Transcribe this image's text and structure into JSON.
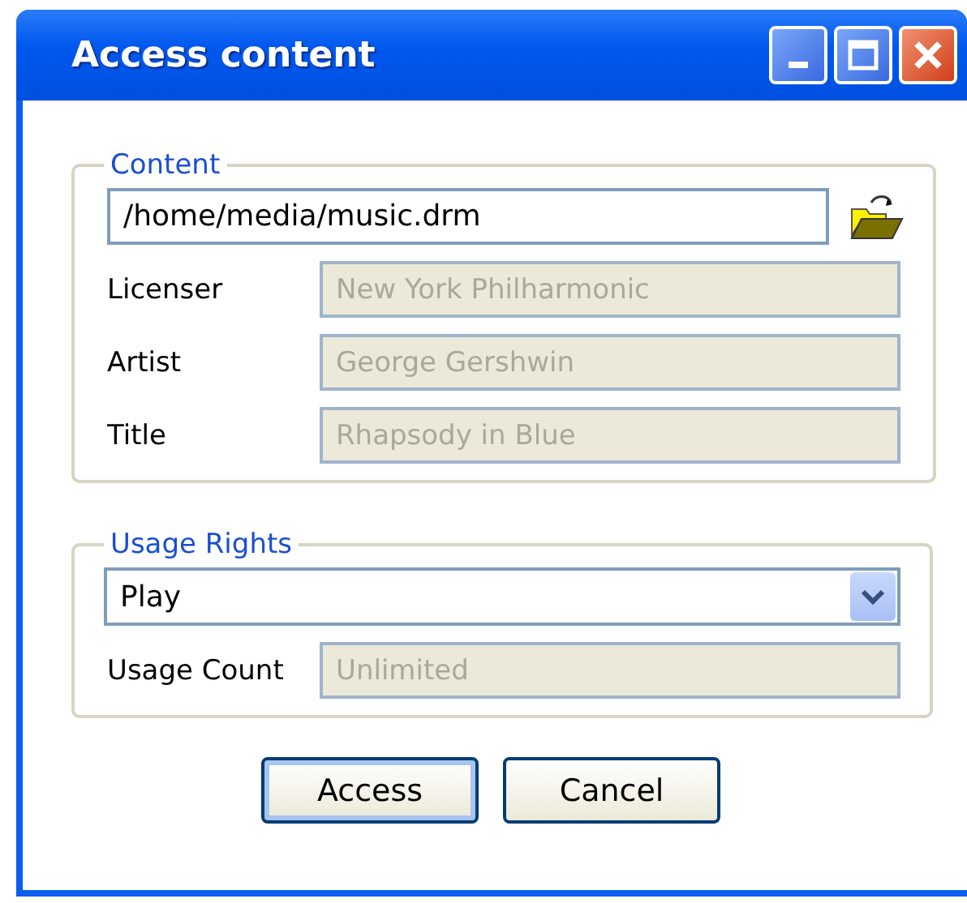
{
  "window": {
    "title": "Access content"
  },
  "content": {
    "legend": "Content",
    "path": "/home/media/music.drm",
    "fields": [
      {
        "label": "Licenser",
        "value": "New York Philharmonic",
        "disabled": true
      },
      {
        "label": "Artist",
        "value": "George Gershwin",
        "disabled": true
      },
      {
        "label": "Title",
        "value": "Rhapsody in Blue",
        "disabled": true
      }
    ]
  },
  "usage_rights": {
    "legend": "Usage Rights",
    "dropdown_value": "Play",
    "fields": [
      {
        "label": "Usage Count",
        "value": "Unlimited",
        "disabled": true
      }
    ]
  },
  "buttons": [
    {
      "label": "Access",
      "default": true
    },
    {
      "label": "Cancel",
      "default": false
    }
  ]
}
